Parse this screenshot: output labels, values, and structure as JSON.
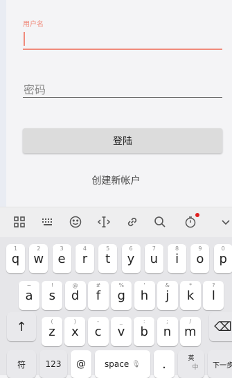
{
  "form": {
    "username_label": "用户名",
    "password_placeholder": "密码",
    "login_button": "登陆",
    "create_account": "创建新帐户"
  },
  "keyboard": {
    "row1": [
      {
        "k": "q",
        "h": "1"
      },
      {
        "k": "w",
        "h": "2"
      },
      {
        "k": "e",
        "h": "3"
      },
      {
        "k": "r",
        "h": "4"
      },
      {
        "k": "t",
        "h": "5"
      },
      {
        "k": "y",
        "h": "6"
      },
      {
        "k": "u",
        "h": "7"
      },
      {
        "k": "i",
        "h": "8"
      },
      {
        "k": "o",
        "h": "9"
      },
      {
        "k": "p",
        "h": "0"
      }
    ],
    "row2": [
      {
        "k": "a",
        "h": "~"
      },
      {
        "k": "s",
        "h": "!"
      },
      {
        "k": "d",
        "h": "@"
      },
      {
        "k": "f",
        "h": "#"
      },
      {
        "k": "g",
        "h": "%"
      },
      {
        "k": "h",
        "h": "'"
      },
      {
        "k": "j",
        "h": "&"
      },
      {
        "k": "k",
        "h": "*"
      },
      {
        "k": "l",
        "h": "?"
      }
    ],
    "row3": [
      {
        "k": "z",
        "h": "("
      },
      {
        "k": "x",
        "h": ")"
      },
      {
        "k": "c",
        "h": "-"
      },
      {
        "k": "v",
        "h": "_"
      },
      {
        "k": "b",
        "h": ":"
      },
      {
        "k": "n",
        "h": ";"
      },
      {
        "k": "m",
        "h": "/"
      }
    ],
    "shift": "↑",
    "backspace": "⌫",
    "symbols": "符",
    "numbers": "123",
    "at": "@",
    "space": "space",
    "period": ".",
    "lang_top": "英",
    "lang_bottom": "中",
    "next": "下一步"
  }
}
